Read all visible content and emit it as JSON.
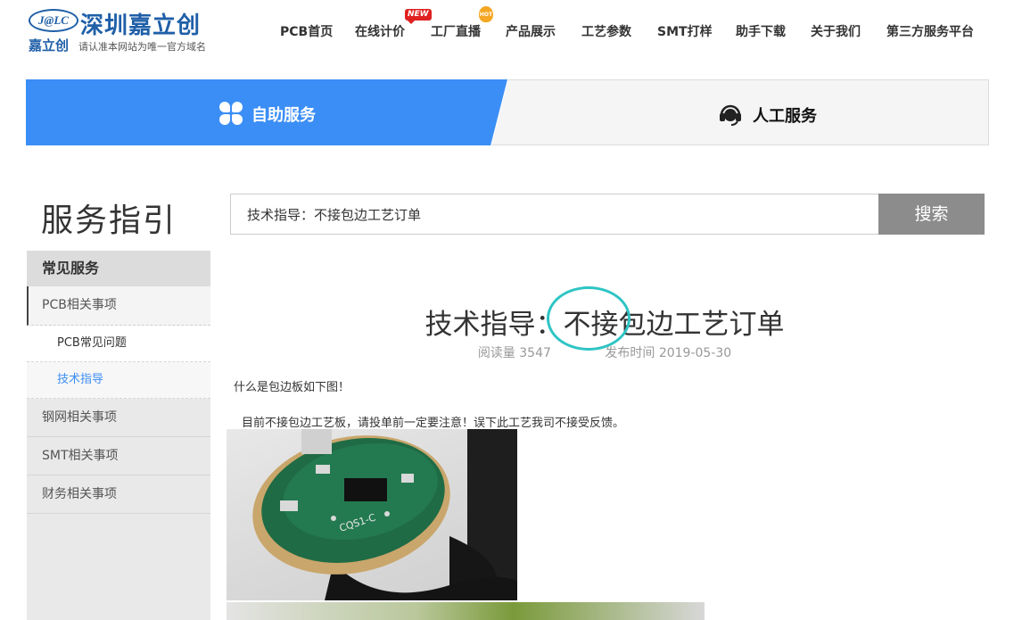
{
  "header": {
    "logo_badge": "J@LC",
    "logo_name": "深圳嘉立创",
    "logo_sub": "嘉立创",
    "logo_slogan": "请认准本网站为唯一官方域名",
    "nav": [
      {
        "label": "PCB首页"
      },
      {
        "label": "在线计价",
        "badge": "NEW"
      },
      {
        "label": "工厂直播",
        "badge": "HOT"
      },
      {
        "label": "产品展示"
      },
      {
        "label": "工艺参数"
      },
      {
        "label": "SMT打样"
      },
      {
        "label": "助手下载"
      },
      {
        "label": "关于我们"
      },
      {
        "label": "第三方服务平台"
      }
    ]
  },
  "service_tabs": {
    "self_service": "自助服务",
    "human_service": "人工服务",
    "active_color": "#3b8ef5"
  },
  "sidebar": {
    "page_heading": "服务指引",
    "section_title": "常见服务",
    "groups": [
      {
        "label": "PCB相关事项",
        "children": [
          "PCB常见问题",
          "技术指导"
        ]
      },
      {
        "label": "钢网相关事项"
      },
      {
        "label": "SMT相关事项"
      },
      {
        "label": "财务相关事项"
      }
    ],
    "current_item": "技术指导"
  },
  "search": {
    "value": "技术指导：不接包边工艺订单",
    "button_label": "搜索"
  },
  "article": {
    "title": "技术指导：不接包边工艺订单",
    "views_label": "阅读量",
    "views": "3547",
    "date_label": "发布时间",
    "date": "2019-05-30",
    "paragraphs": [
      "什么是包边板如下图！",
      "目前不接包边工艺板，请投单前一定要注意！误下此工艺我司不接受反馈。"
    ],
    "image_silkscreen": "CQS1-C"
  }
}
